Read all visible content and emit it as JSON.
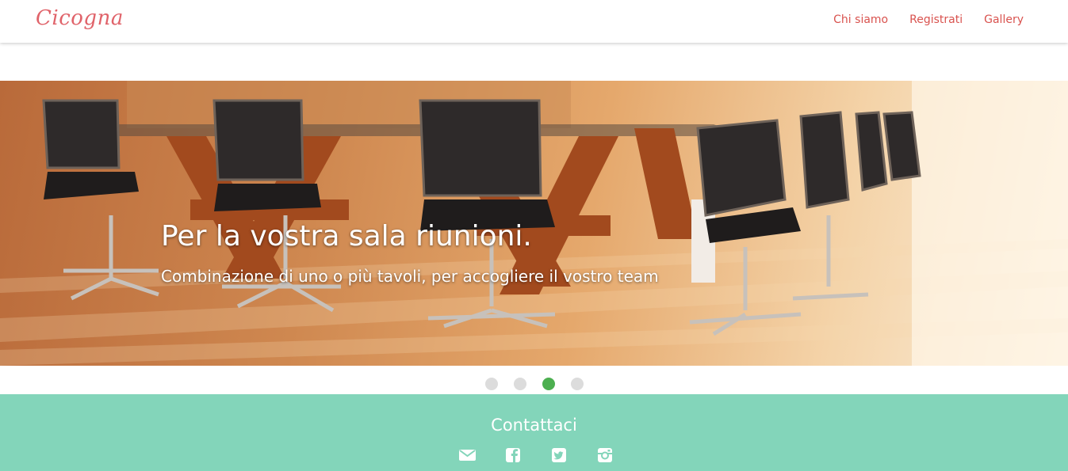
{
  "navbar": {
    "brand": "Cicogna",
    "links": [
      {
        "label": "Chi siamo"
      },
      {
        "label": "Registrati"
      },
      {
        "label": "Gallery"
      }
    ]
  },
  "hero": {
    "title": "Per la vostra sala riunioni.",
    "subtitle": "Combinazione di uno o più tavoli, per accogliere il vostro team",
    "slides_total": 4,
    "active_slide": 3
  },
  "footer": {
    "title": "Contattaci",
    "icons": [
      "envelope-icon",
      "facebook-icon",
      "twitter-icon",
      "instagram-icon"
    ]
  },
  "colors": {
    "brand": "#e0636a",
    "nav_link": "#d9534f",
    "indicator_active": "#4caf50",
    "indicator_inactive": "#dcdcdc",
    "footer_bg": "#83d5ba"
  }
}
